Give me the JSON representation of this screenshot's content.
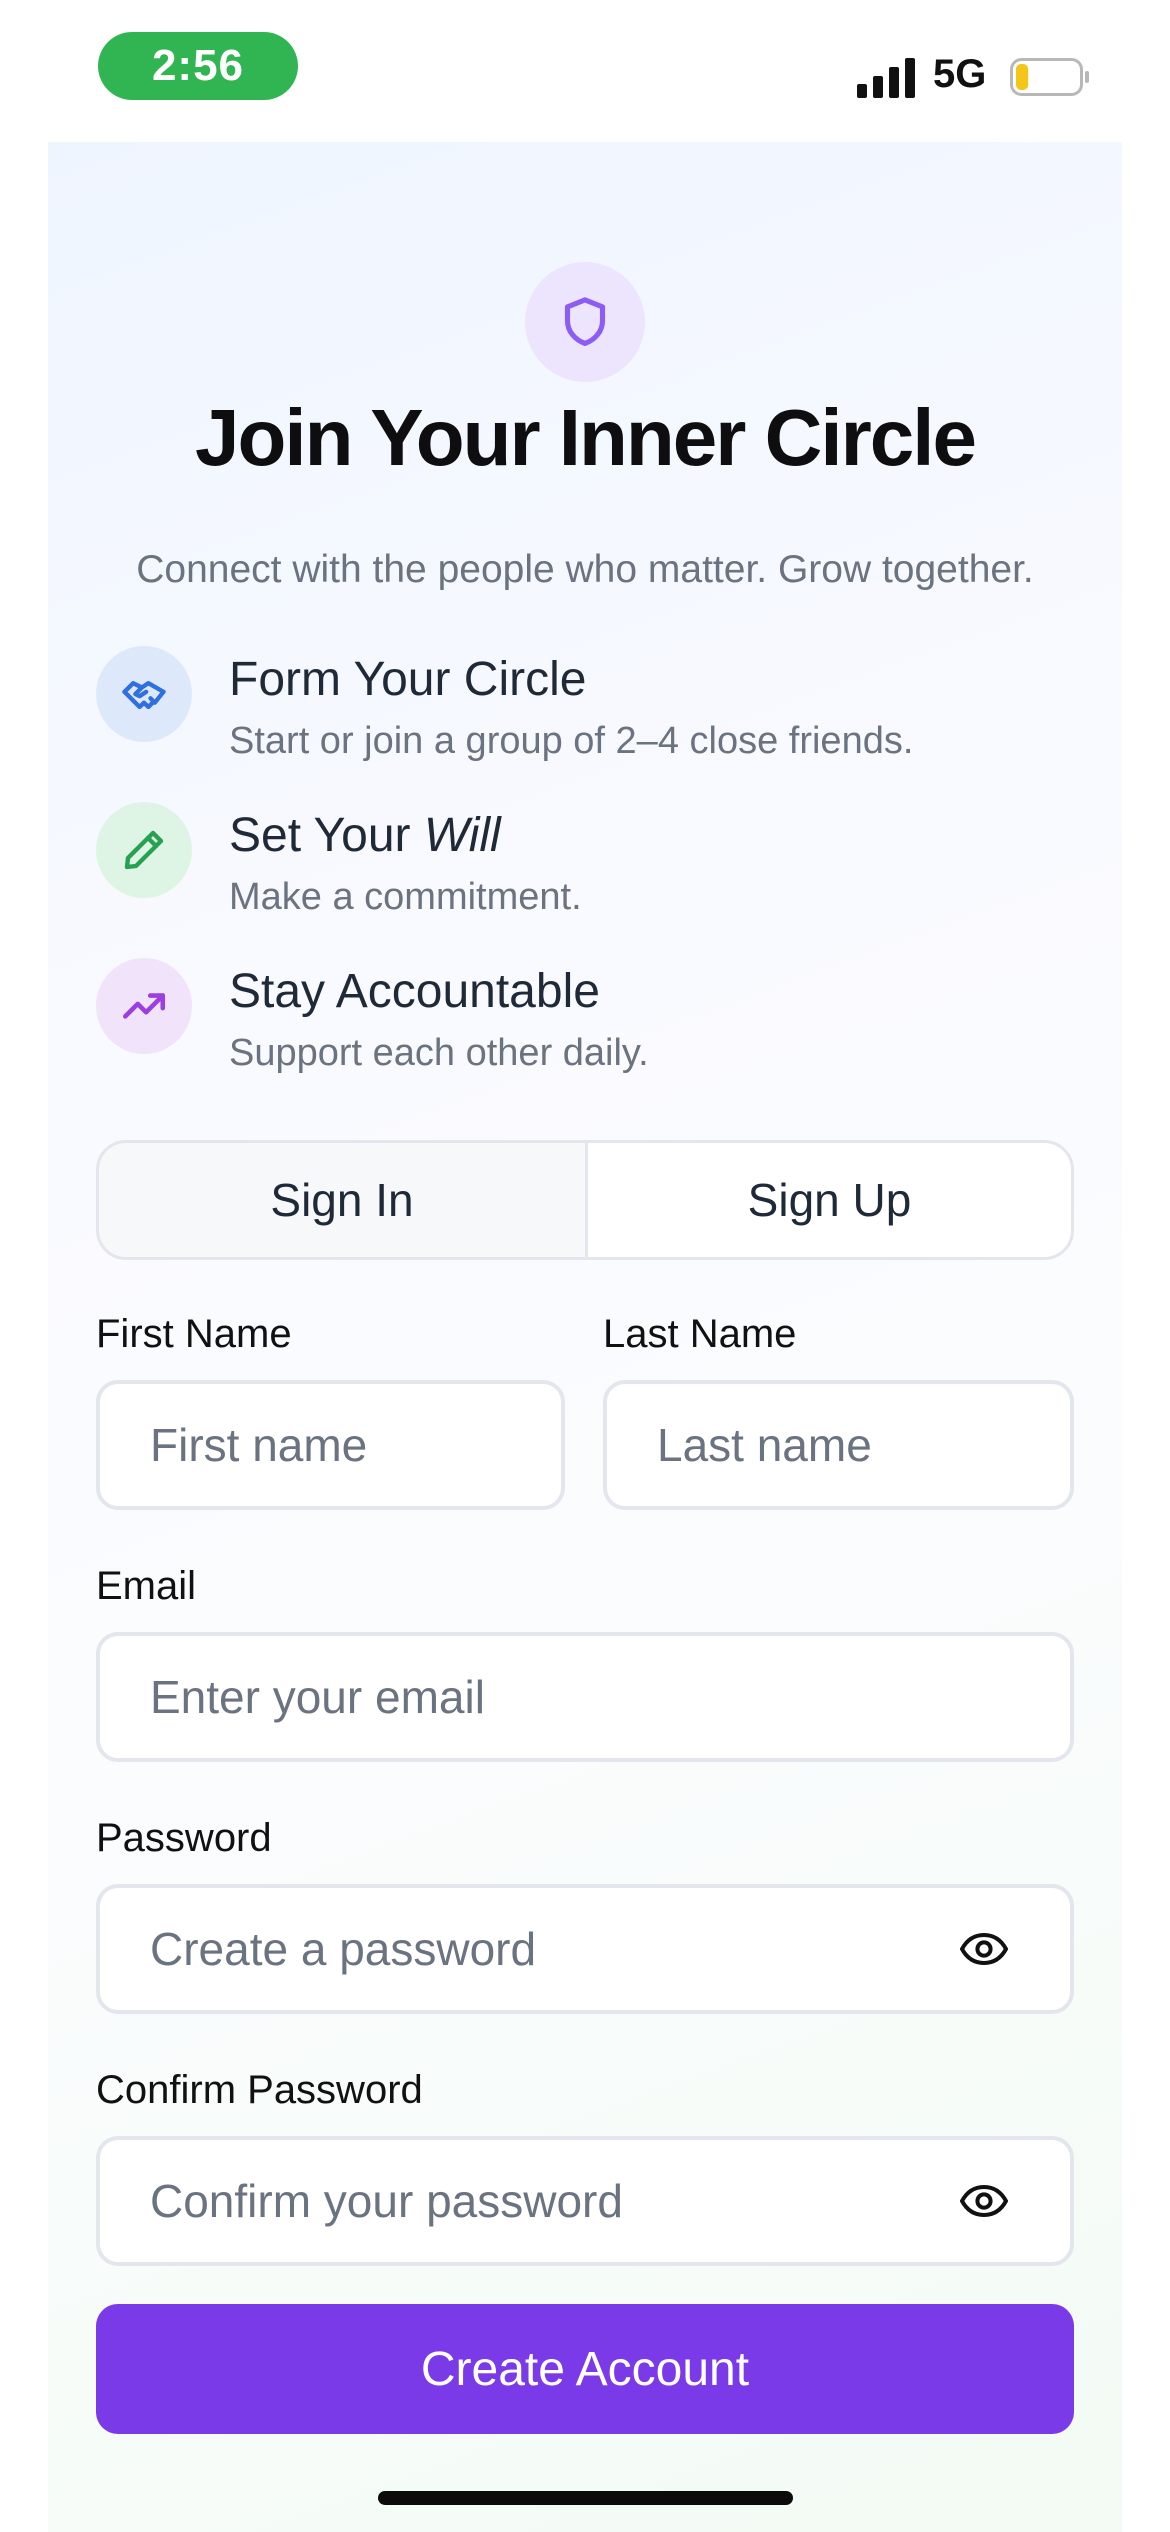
{
  "status_bar": {
    "time": "2:56",
    "network": "5G"
  },
  "header": {
    "title": "Join Your Inner Circle",
    "subtitle": "Connect with the people who matter. Grow together."
  },
  "features": [
    {
      "icon": "handshake-icon",
      "title": "Form Your Circle",
      "description": "Start or join a group of 2–4 close friends."
    },
    {
      "icon": "pencil-icon",
      "title_prefix": "Set Your ",
      "title_emphasis": "Will",
      "description": "Make a commitment."
    },
    {
      "icon": "trending-up-icon",
      "title": "Stay Accountable",
      "description": "Support each other daily."
    }
  ],
  "auth_tabs": {
    "sign_in": "Sign In",
    "sign_up": "Sign Up",
    "selected": "Sign Up"
  },
  "form": {
    "first_name": {
      "label": "First Name",
      "placeholder": "First name",
      "value": ""
    },
    "last_name": {
      "label": "Last Name",
      "placeholder": "Last name",
      "value": ""
    },
    "email": {
      "label": "Email",
      "placeholder": "Enter your email",
      "value": ""
    },
    "password": {
      "label": "Password",
      "placeholder": "Create a password",
      "value": ""
    },
    "confirm_password": {
      "label": "Confirm Password",
      "placeholder": "Confirm your password",
      "value": ""
    },
    "submit_label": "Create Account"
  },
  "colors": {
    "accent": "#7b3ae8",
    "time_pill": "#30b552",
    "battery_level": "#f5c518",
    "feature_icon_blue": "#2f6fe0",
    "feature_icon_green": "#26a151",
    "feature_icon_purple": "#9b3fe0"
  },
  "battery_level_fraction": 0.2
}
